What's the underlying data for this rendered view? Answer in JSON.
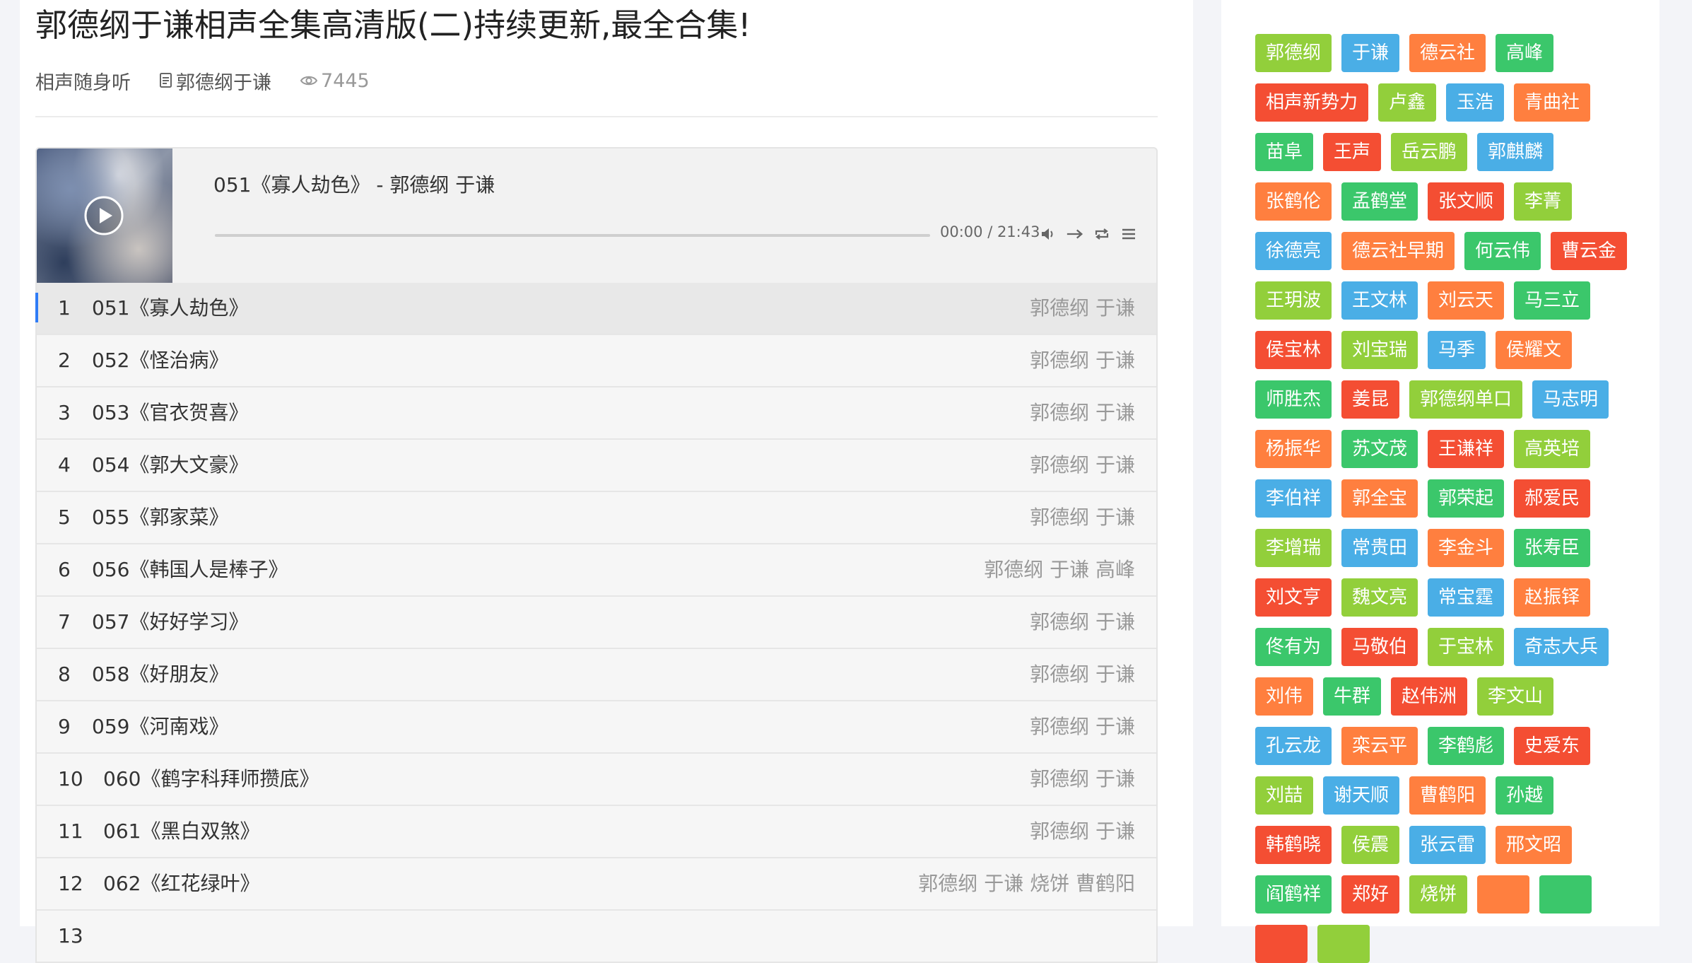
{
  "page": {
    "title": "郭德纲于谦相声全集高清版(二)持续更新,最全合集!",
    "category": "相声随身听",
    "artist_tag": "郭德纲于谦",
    "views": "7445"
  },
  "player": {
    "now_playing": "051《寡人劫色》 - 郭德纲 于谦",
    "time": "00:00 / 21:43",
    "progress_fraction": 0,
    "accent_color": "#2f7cf6",
    "icons": [
      "play-icon",
      "volume-icon",
      "order-icon",
      "loop-icon",
      "list-icon"
    ]
  },
  "playlist": [
    {
      "num": "1",
      "title": "051《寡人劫色》",
      "artist": "郭德纲 于谦"
    },
    {
      "num": "2",
      "title": "052《怪治病》",
      "artist": "郭德纲 于谦"
    },
    {
      "num": "3",
      "title": "053《官衣贺喜》",
      "artist": "郭德纲 于谦"
    },
    {
      "num": "4",
      "title": "054《郭大文豪》",
      "artist": "郭德纲 于谦"
    },
    {
      "num": "5",
      "title": "055《郭家菜》",
      "artist": "郭德纲 于谦"
    },
    {
      "num": "6",
      "title": "056《韩国人是棒子》",
      "artist": "郭德纲 于谦 高峰"
    },
    {
      "num": "7",
      "title": "057《好好学习》",
      "artist": "郭德纲 于谦"
    },
    {
      "num": "8",
      "title": "058《好朋友》",
      "artist": "郭德纲 于谦"
    },
    {
      "num": "9",
      "title": "059《河南戏》",
      "artist": "郭德纲 于谦"
    },
    {
      "num": "10",
      "title": "060《鹤字科拜师攒底》",
      "artist": "郭德纲 于谦"
    },
    {
      "num": "11",
      "title": "061《黑白双煞》",
      "artist": "郭德纲 于谦"
    },
    {
      "num": "12",
      "title": "062《红花绿叶》",
      "artist": "郭德纲 于谦 烧饼 曹鹤阳"
    },
    {
      "num": "13",
      "title": "",
      "artist": ""
    }
  ],
  "tag_colors": {
    "green": "#3bc76b",
    "orange": "#ff7f3f",
    "red": "#f44e33",
    "blue": "#4aaee6",
    "lime": "#92cf3b"
  },
  "tags": [
    {
      "label": "郭德纲",
      "color": "lime"
    },
    {
      "label": "于谦",
      "color": "blue"
    },
    {
      "label": "德云社",
      "color": "orange"
    },
    {
      "label": "高峰",
      "color": "green"
    },
    {
      "label": "相声新势力",
      "color": "red"
    },
    {
      "label": "卢鑫",
      "color": "lime"
    },
    {
      "label": "玉浩",
      "color": "blue"
    },
    {
      "label": "青曲社",
      "color": "orange"
    },
    {
      "label": "苗阜",
      "color": "green"
    },
    {
      "label": "王声",
      "color": "red"
    },
    {
      "label": "岳云鹏",
      "color": "lime"
    },
    {
      "label": "郭麒麟",
      "color": "blue"
    },
    {
      "label": "张鹤伦",
      "color": "orange"
    },
    {
      "label": "孟鹤堂",
      "color": "green"
    },
    {
      "label": "张文顺",
      "color": "red"
    },
    {
      "label": "李菁",
      "color": "lime"
    },
    {
      "label": "徐德亮",
      "color": "blue"
    },
    {
      "label": "德云社早期",
      "color": "orange"
    },
    {
      "label": "何云伟",
      "color": "green"
    },
    {
      "label": "曹云金",
      "color": "red"
    },
    {
      "label": "王玥波",
      "color": "lime"
    },
    {
      "label": "王文林",
      "color": "blue"
    },
    {
      "label": "刘云天",
      "color": "orange"
    },
    {
      "label": "马三立",
      "color": "green"
    },
    {
      "label": "侯宝林",
      "color": "red"
    },
    {
      "label": "刘宝瑞",
      "color": "lime"
    },
    {
      "label": "马季",
      "color": "blue"
    },
    {
      "label": "侯耀文",
      "color": "orange"
    },
    {
      "label": "师胜杰",
      "color": "green"
    },
    {
      "label": "姜昆",
      "color": "red"
    },
    {
      "label": "郭德纲单口",
      "color": "lime"
    },
    {
      "label": "马志明",
      "color": "blue"
    },
    {
      "label": "杨振华",
      "color": "orange"
    },
    {
      "label": "苏文茂",
      "color": "green"
    },
    {
      "label": "王谦祥",
      "color": "red"
    },
    {
      "label": "高英培",
      "color": "lime"
    },
    {
      "label": "李伯祥",
      "color": "blue"
    },
    {
      "label": "郭全宝",
      "color": "orange"
    },
    {
      "label": "郭荣起",
      "color": "green"
    },
    {
      "label": "郝爱民",
      "color": "red"
    },
    {
      "label": "李增瑞",
      "color": "lime"
    },
    {
      "label": "常贵田",
      "color": "blue"
    },
    {
      "label": "李金斗",
      "color": "orange"
    },
    {
      "label": "张寿臣",
      "color": "green"
    },
    {
      "label": "刘文亨",
      "color": "red"
    },
    {
      "label": "魏文亮",
      "color": "lime"
    },
    {
      "label": "常宝霆",
      "color": "blue"
    },
    {
      "label": "赵振铎",
      "color": "orange"
    },
    {
      "label": "佟有为",
      "color": "green"
    },
    {
      "label": "马敬伯",
      "color": "red"
    },
    {
      "label": "于宝林",
      "color": "lime"
    },
    {
      "label": "奇志大兵",
      "color": "blue"
    },
    {
      "label": "刘伟",
      "color": "orange"
    },
    {
      "label": "牛群",
      "color": "green"
    },
    {
      "label": "赵伟洲",
      "color": "red"
    },
    {
      "label": "李文山",
      "color": "lime"
    },
    {
      "label": "孔云龙",
      "color": "blue"
    },
    {
      "label": "栾云平",
      "color": "orange"
    },
    {
      "label": "李鹤彪",
      "color": "green"
    },
    {
      "label": "史爱东",
      "color": "red"
    },
    {
      "label": "刘喆",
      "color": "lime"
    },
    {
      "label": "谢天顺",
      "color": "blue"
    },
    {
      "label": "曹鹤阳",
      "color": "orange"
    },
    {
      "label": "孙越",
      "color": "green"
    },
    {
      "label": "韩鹤晓",
      "color": "red"
    },
    {
      "label": "侯震",
      "color": "lime"
    },
    {
      "label": "张云雷",
      "color": "blue"
    },
    {
      "label": "邢文昭",
      "color": "orange"
    },
    {
      "label": "阎鹤祥",
      "color": "green"
    },
    {
      "label": "郑好",
      "color": "red"
    },
    {
      "label": "烧饼",
      "color": "lime"
    },
    {
      "label": "",
      "color": "orange"
    },
    {
      "label": "",
      "color": "green"
    },
    {
      "label": "",
      "color": "red"
    },
    {
      "label": "",
      "color": "lime"
    }
  ]
}
